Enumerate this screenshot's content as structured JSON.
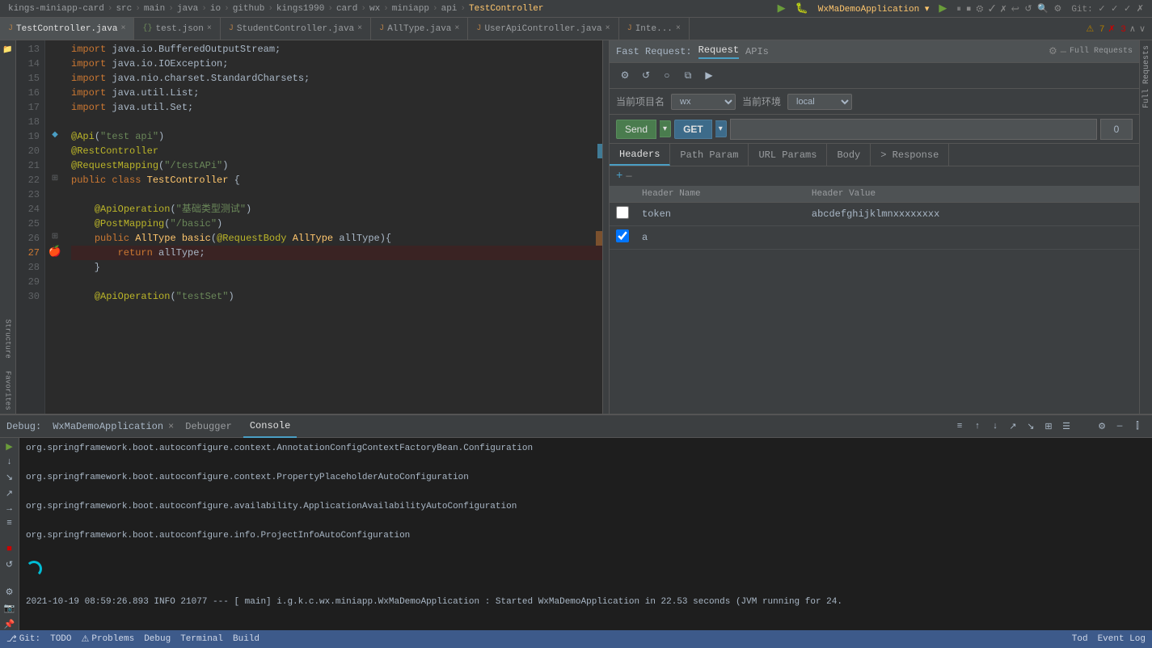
{
  "breadcrumb": {
    "items": [
      "kings-miniapp-card",
      "src",
      "main",
      "java",
      "io",
      "github",
      "kings1990",
      "card",
      "wx",
      "miniapp",
      "api",
      "TestController"
    ]
  },
  "tabs": [
    {
      "id": "test-controller",
      "label": "TestController.java",
      "type": "java",
      "active": true,
      "closable": true
    },
    {
      "id": "test-json",
      "label": "test.json",
      "type": "json",
      "active": false,
      "closable": true
    },
    {
      "id": "student-controller",
      "label": "StudentController.java",
      "type": "java",
      "active": false,
      "closable": true
    },
    {
      "id": "alltype",
      "label": "AllType.java",
      "type": "java",
      "active": false,
      "closable": true
    },
    {
      "id": "userapicontroller",
      "label": "UserApiController.java",
      "type": "java",
      "active": false,
      "closable": true
    },
    {
      "id": "inte",
      "label": "Inte...",
      "type": "java",
      "active": false,
      "closable": true
    }
  ],
  "warnings": {
    "count": 7,
    "errors": 3
  },
  "code_lines": [
    {
      "num": 13,
      "content": "import java.io.BufferedOutputStream;",
      "highlighted": false
    },
    {
      "num": 14,
      "content": "import java.io.IOException;",
      "highlighted": false
    },
    {
      "num": 15,
      "content": "import java.nio.charset.StandardCharsets;",
      "highlighted": false
    },
    {
      "num": 16,
      "content": "import java.util.List;",
      "highlighted": false
    },
    {
      "num": 17,
      "content": "import java.util.Set;",
      "highlighted": false
    },
    {
      "num": 18,
      "content": "",
      "highlighted": false
    },
    {
      "num": 19,
      "content": "@Api(\"test api\")",
      "highlighted": false,
      "annotation": true
    },
    {
      "num": 20,
      "content": "@RestController",
      "highlighted": false,
      "annotation": true
    },
    {
      "num": 21,
      "content": "@RequestMapping(\"/testAPi\")",
      "highlighted": false,
      "annotation": true
    },
    {
      "num": 22,
      "content": "public class TestController {",
      "highlighted": false
    },
    {
      "num": 23,
      "content": "",
      "highlighted": false
    },
    {
      "num": 24,
      "content": "    @ApiOperation(\"基础类型测试\")",
      "highlighted": false,
      "annotation": true
    },
    {
      "num": 25,
      "content": "    @PostMapping(\"/basic\")",
      "highlighted": false,
      "annotation": true
    },
    {
      "num": 26,
      "content": "    public AllType basic(@RequestBody AllType allType){",
      "highlighted": false
    },
    {
      "num": 27,
      "content": "        return allType;",
      "highlighted": true
    },
    {
      "num": 28,
      "content": "    }",
      "highlighted": false
    },
    {
      "num": 29,
      "content": "",
      "highlighted": false
    },
    {
      "num": 30,
      "content": "    @ApiOperation(\"testSet\")",
      "highlighted": false,
      "annotation": true
    }
  ],
  "right_panel": {
    "title": "Fast Request:",
    "tabs": [
      "Request",
      "APIs"
    ],
    "active_tab": "Request",
    "toolbar_icons": [
      "settings",
      "refresh",
      "circle",
      "copy",
      "play"
    ],
    "project_label": "当前项目名",
    "project_value": "wx",
    "env_label": "当前环境",
    "env_value": "local",
    "send_label": "Send",
    "method": "GET",
    "url_value": "",
    "timeout_value": "0",
    "request_tabs": [
      "Headers",
      "Path Param",
      "URL Params",
      "Body",
      "> Response"
    ],
    "active_request_tab": "Headers",
    "headers": [
      {
        "enabled": false,
        "name": "token",
        "value": "abcdefghijklmnxxxxxxxx"
      },
      {
        "enabled": true,
        "name": "a",
        "value": ""
      }
    ]
  },
  "debug": {
    "title": "Debug:",
    "app_name": "WxMaDemoApplication",
    "tabs": [
      "Debugger",
      "Console"
    ],
    "active_tab": "Console",
    "console_lines": [
      {
        "text": "org.springframework.boot.autoconfigure.context.AnnotationConfigContextFactoryBean.Configuration",
        "type": "info"
      },
      {
        "text": "org.springframework.boot.autoconfigure.context.PropertyPlaceholderAutoConfiguration",
        "type": "info"
      },
      {
        "text": "org.springframework.boot.autoconfigure.availability.ApplicationAvailabilityAutoConfiguration",
        "type": "info"
      },
      {
        "text": "org.springframework.boot.autoconfigure.info.ProjectInfoAutoConfiguration",
        "type": "info"
      },
      {
        "text": "",
        "type": "info"
      },
      {
        "text": "2021-10-19 08:59:26.893  INFO 21077 --- [          main] i.g.k.c.wx.miniapp.WxMaDemoApplication  : Started WxMaDemoApplication in 22.53 seconds (JVM running for 24.",
        "type": "info"
      }
    ]
  },
  "status_bar": {
    "git": "Git:",
    "todo": "TODO",
    "problems": "Problems",
    "debug": "Debug",
    "terminal": "Terminal",
    "build": "Build",
    "event_log": "Event Log",
    "git_branch": "↓ Git",
    "tod_label": "Tod"
  }
}
